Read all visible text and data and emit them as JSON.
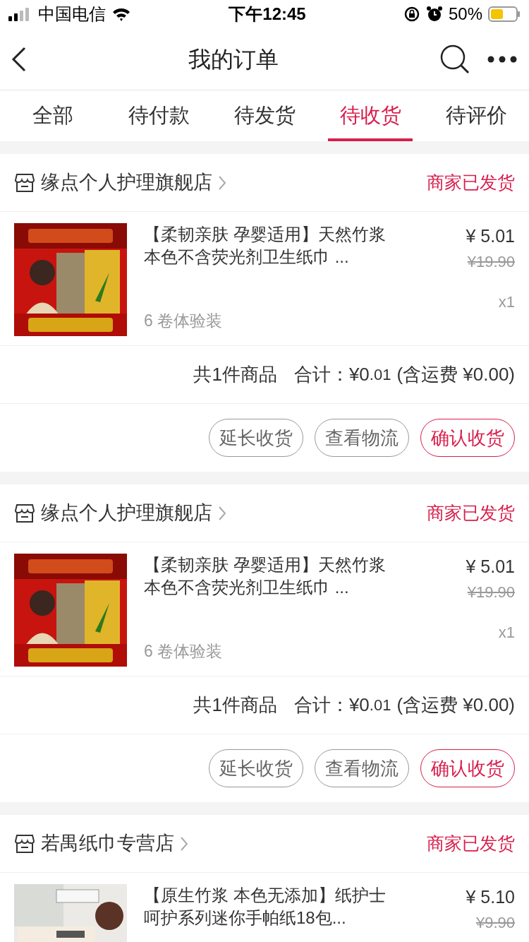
{
  "status_bar": {
    "carrier": "中国电信",
    "time": "下午12:45",
    "battery": "50%"
  },
  "nav": {
    "title": "我的订单"
  },
  "tabs": [
    {
      "label": "全部",
      "selected": false
    },
    {
      "label": "待付款",
      "selected": false
    },
    {
      "label": "待发货",
      "selected": false
    },
    {
      "label": "待收货",
      "selected": true
    },
    {
      "label": "待评价",
      "selected": false
    }
  ],
  "orders": [
    {
      "shop": "缘点个人护理旗舰店",
      "status": "商家已发货",
      "items": [
        {
          "kind": "picture",
          "title": "【柔韧亲肤 孕婴适用】天然竹浆本色不含荧光剂卫生纸巾 ...",
          "variant": "6 卷体验装",
          "price": "¥ 5.01",
          "original_price": "¥19.90",
          "quantity": "x1"
        }
      ],
      "summary": {
        "count": "共1件商品",
        "total_label": "合计：",
        "total_int": "¥0",
        "total_dec": ".01",
        "shipping": "(含运费 ¥0.00)"
      },
      "actions": [
        {
          "label": "延长收货",
          "kind": "outline"
        },
        {
          "label": "查看物流",
          "kind": "outline"
        },
        {
          "label": "确认收货",
          "kind": "primary"
        }
      ]
    },
    {
      "shop": "缘点个人护理旗舰店",
      "status": "商家已发货",
      "items": [
        {
          "kind": "picture",
          "title": "【柔韧亲肤 孕婴适用】天然竹浆本色不含荧光剂卫生纸巾 ...",
          "variant": "6 卷体验装",
          "price": "¥ 5.01",
          "original_price": "¥19.90",
          "quantity": "x1"
        }
      ],
      "summary": {
        "count": "共1件商品",
        "total_label": "合计：",
        "total_int": "¥0",
        "total_dec": ".01",
        "shipping": "(含运费 ¥0.00)"
      },
      "actions": [
        {
          "label": "延长收货",
          "kind": "outline"
        },
        {
          "label": "查看物流",
          "kind": "outline"
        },
        {
          "label": "确认收货",
          "kind": "primary"
        }
      ]
    },
    {
      "shop": "若禺纸巾专营店",
      "status": "商家已发货",
      "items": [
        {
          "kind": "picture",
          "title": "【原生竹浆 本色无添加】纸护士呵护系列迷你手帕纸18包...",
          "price": "¥ 5.10",
          "original_price": "¥9.90"
        }
      ]
    }
  ]
}
